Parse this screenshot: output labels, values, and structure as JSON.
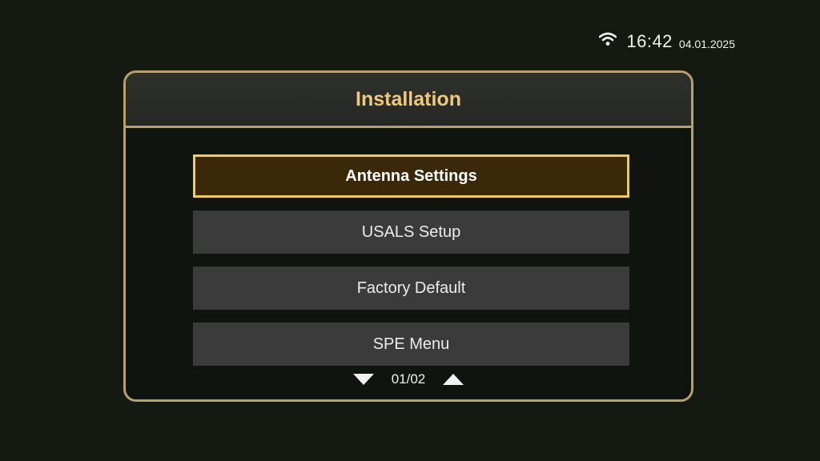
{
  "status": {
    "wifi_icon": "wifi-icon",
    "time": "16:42",
    "date": "04.01.2025"
  },
  "panel": {
    "title": "Installation"
  },
  "menu": {
    "items": [
      {
        "label": "Antenna Settings",
        "selected": true
      },
      {
        "label": "USALS Setup",
        "selected": false
      },
      {
        "label": "Factory Default",
        "selected": false
      },
      {
        "label": "SPE Menu",
        "selected": false
      }
    ]
  },
  "pager": {
    "page": "01/02",
    "prev_icon": "triangle-down-icon",
    "next_icon": "triangle-up-icon"
  },
  "colors": {
    "accent_gold": "#b9a06a",
    "title_gold": "#f0c878",
    "selection_border": "#f2cc50",
    "selection_fill": "#3a2808",
    "item_fill": "#3b3b3b",
    "background": "#141a12"
  }
}
